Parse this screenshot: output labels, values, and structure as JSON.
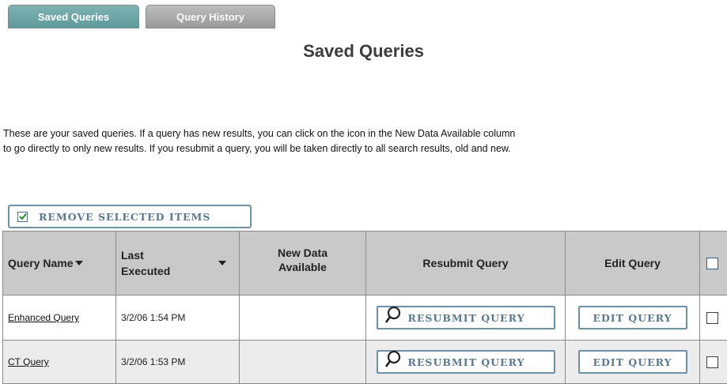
{
  "tabs": [
    {
      "label": "Saved Queries",
      "active": true
    },
    {
      "label": "Query History",
      "active": false
    }
  ],
  "page_title": "Saved Queries",
  "intro": {
    "line1": "These are your saved queries. If a query has new results, you can click on the icon in the New Data Available column",
    "line2": "to go directly to only new results. If you resubmit a query, you will be taken directly to all search results, old and new."
  },
  "remove_button": {
    "label": "REMOVE SELECTED ITEMS",
    "icon": "checkmark-icon"
  },
  "table": {
    "headers": {
      "query_name": "Query Name",
      "last_executed_1": "Last",
      "last_executed_2": "Executed",
      "new_data_1": "New Data",
      "new_data_2": "Available",
      "resubmit": "Resubmit Query",
      "edit": "Edit Query"
    },
    "rows": [
      {
        "name": "Enhanced Query",
        "executed": "3/2/06 1:54 PM",
        "new_data": "",
        "resubmit_label": "RESUBMIT QUERY",
        "edit_label": "EDIT QUERY"
      },
      {
        "name": "CT Query",
        "executed": "3/2/06 1:53 PM",
        "new_data": "",
        "resubmit_label": "RESUBMIT QUERY",
        "edit_label": "EDIT QUERY"
      }
    ]
  },
  "colors": {
    "active_tab": "#6fa6a7",
    "inactive_tab": "#aaaaaa",
    "button_border": "#6f8fa6",
    "button_text": "#5a7891",
    "header_bg": "#c9c9c9"
  }
}
